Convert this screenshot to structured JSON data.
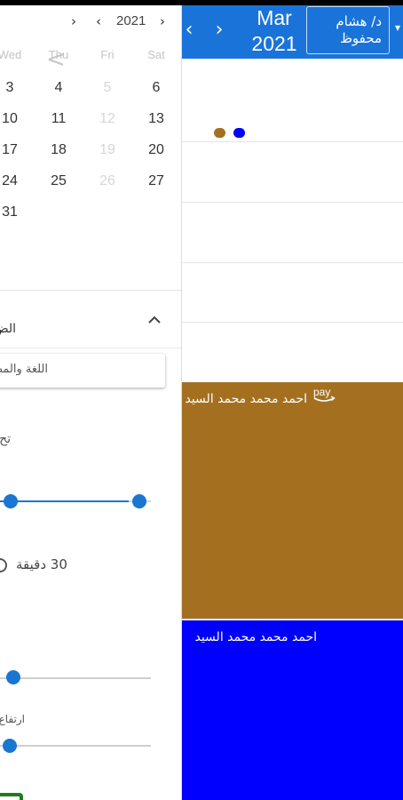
{
  "header": {
    "prev_glyph": "‹",
    "next_glyph": "›",
    "month": "Mar",
    "year": "2021",
    "user": "د/ هشام محفوظ",
    "caret": "▾",
    "color": "#1a73d9"
  },
  "events": [
    {
      "title": "احمد محمد محمد السيد",
      "color": "#a47020",
      "icon": "amazon-pay-icon",
      "icon_text": "pay"
    },
    {
      "title": "احمد محمد محمد السيد",
      "color": "#0000ff"
    }
  ],
  "day_dots": [
    "#a47020",
    "#0000ff"
  ],
  "mini_calendar": {
    "year": "2021",
    "nav_left": "›",
    "nav_prev": "‹",
    "nav_next": "›",
    "back_arrow": "<",
    "weekdays": [
      "Wed",
      "Thu",
      "Fri",
      "Sat"
    ],
    "rows": [
      [
        "3",
        "4",
        "5",
        "6"
      ],
      [
        "10",
        "11",
        "12",
        "13"
      ],
      [
        "17",
        "18",
        "19",
        "20"
      ],
      [
        "24",
        "25",
        "26",
        "27"
      ],
      [
        "31",
        "",
        "",
        ""
      ]
    ],
    "muted_days": [
      "5",
      "12",
      "19",
      "26"
    ]
  },
  "settings": {
    "title": "الض",
    "select_value": "اللغة والمظهر",
    "label_fragment": "تح",
    "range": {
      "start": 0.0,
      "end": 0.85
    },
    "duration": "30 دقيقة",
    "slider2_value": 0.0,
    "height_label": "ارتفاع",
    "slider3_value": 0.0,
    "accent_color": "#1976d2",
    "button_color": "#1f7a1f"
  }
}
